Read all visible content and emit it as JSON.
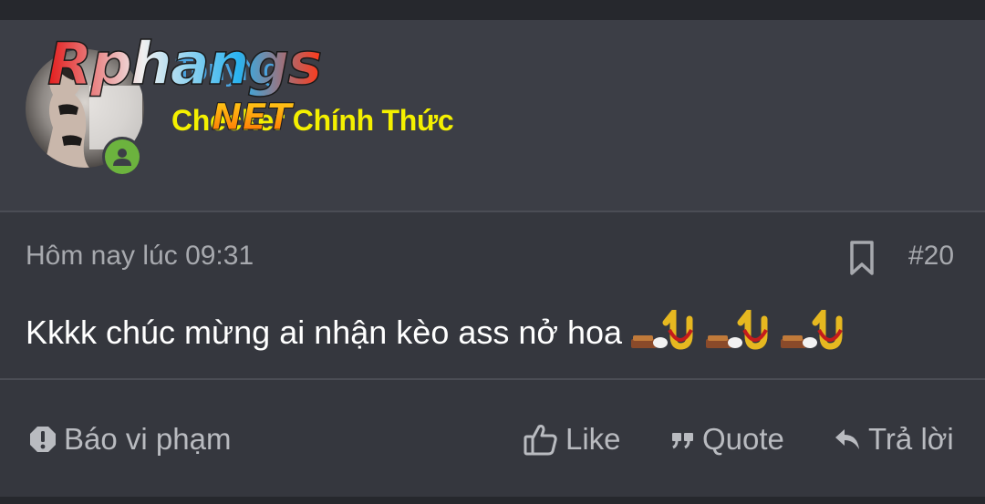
{
  "post": {
    "user": {
      "name": "TonyNg",
      "title": "Checker Chính Thức",
      "online": true
    },
    "watermark": {
      "line1": "Rphangs",
      "line2": "NET"
    },
    "meta": {
      "timestamp": "Hôm nay lúc 09:31",
      "post_number": "#20"
    },
    "message": {
      "text": "Kkkk chúc mừng ai nhận kèo ass nở hoa",
      "smilies": [
        "smilie-icon",
        "smilie-icon",
        "smilie-icon"
      ]
    },
    "actions": {
      "report": "Báo vi phạm",
      "like": "Like",
      "quote": "Quote",
      "reply": "Trả lời"
    }
  },
  "colors": {
    "background": "#2b2d33",
    "header_bg": "#3c3e46",
    "username": "#4aa3df",
    "user_title": "#f4f000",
    "online": "#6cb33e",
    "muted_text": "#a7a9ae"
  }
}
